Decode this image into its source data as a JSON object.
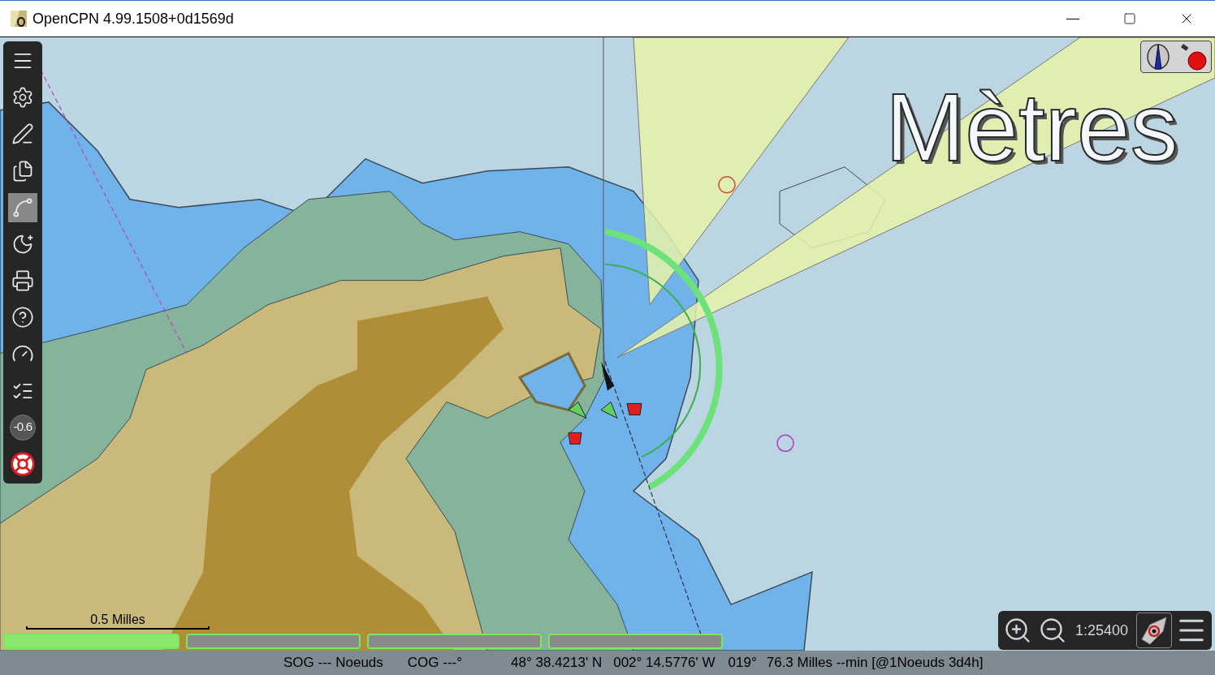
{
  "window": {
    "title": "OpenCPN 4.99.1508+0d1569d"
  },
  "toolbar": {
    "items": [
      {
        "kind": "menu",
        "selected": false
      },
      {
        "kind": "settings",
        "selected": false
      },
      {
        "kind": "route",
        "selected": false
      },
      {
        "kind": "pages",
        "selected": false
      },
      {
        "kind": "track",
        "selected": true
      },
      {
        "kind": "night",
        "selected": false
      },
      {
        "kind": "print",
        "selected": false
      },
      {
        "kind": "help",
        "selected": false
      },
      {
        "kind": "dashboard",
        "selected": false
      },
      {
        "kind": "ais",
        "selected": false
      },
      {
        "kind": "tide",
        "selected": false,
        "label": "-0.6"
      },
      {
        "kind": "mob",
        "selected": false
      }
    ]
  },
  "chart": {
    "units_label": "Mètres",
    "scale_label": "0.5 Milles"
  },
  "chart_bar": [
    {
      "selected": true
    },
    {
      "selected": false
    },
    {
      "selected": false
    },
    {
      "selected": false
    }
  ],
  "zoom_panel": {
    "scale": "1:25400"
  },
  "status_bar": {
    "sog": "SOG --- Noeuds",
    "cog": "COG ---°",
    "lat": "48° 38.4213' N",
    "lon": "002° 14.5776' W",
    "bearing": "019°",
    "route": "76.3 Milles --min [@1Noeuds 3d4h]"
  }
}
